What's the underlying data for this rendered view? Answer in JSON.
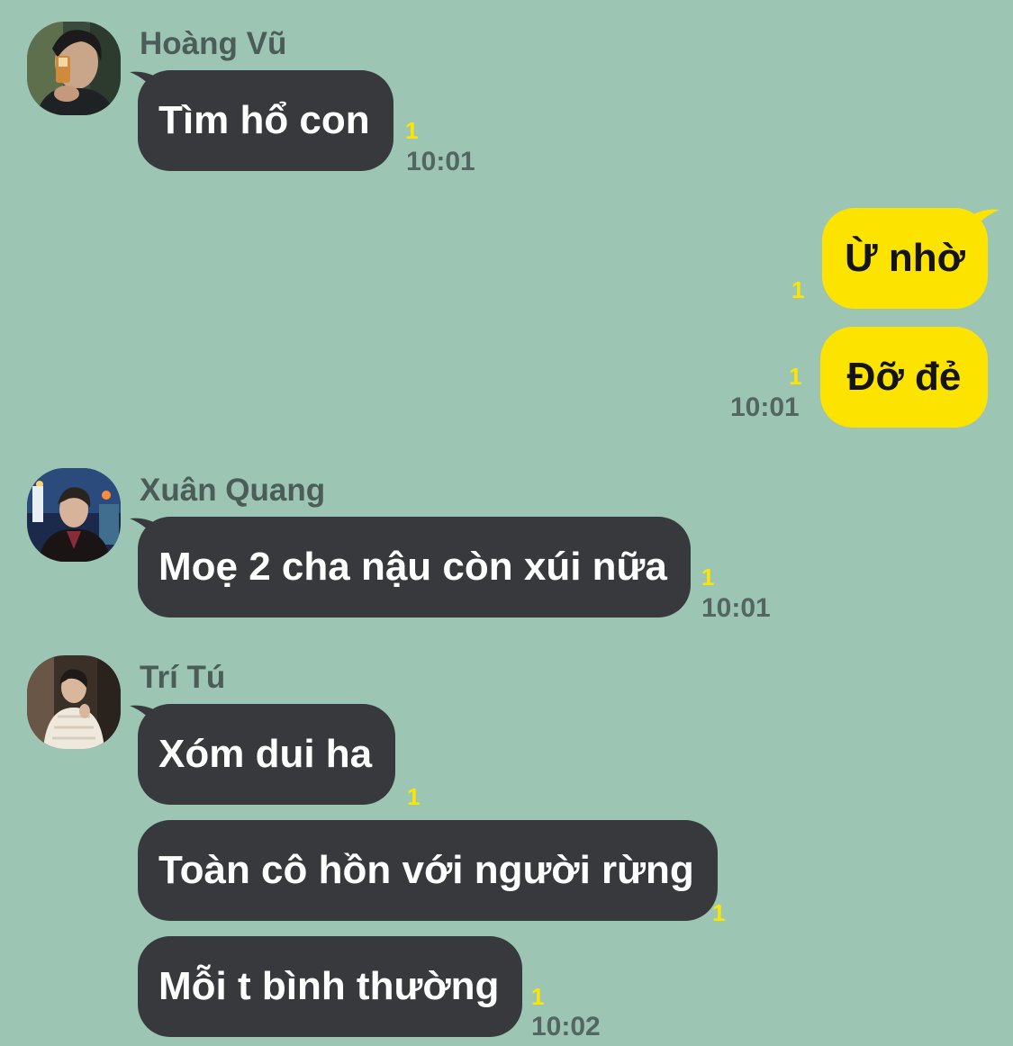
{
  "colors": {
    "background": "#9cc5b4",
    "incoming_bubble": "#37393d",
    "outgoing_bubble": "#fde300",
    "unread_count": "#fce500",
    "meta_text": "#536660"
  },
  "messages": {
    "hoang_vu": {
      "sender": "Hoàng Vũ",
      "avatar": "profile-photo",
      "text": "Tìm hổ con",
      "unread": "1",
      "time": "10:01"
    },
    "me_1": {
      "text": "Ừ nhờ",
      "unread": "1"
    },
    "me_2": {
      "text": "Đỡ đẻ",
      "unread": "1",
      "time": "10:01"
    },
    "xuan_quang": {
      "sender": "Xuân Quang",
      "avatar": "profile-photo",
      "text": "Moẹ 2 cha nậu còn xúi nữa",
      "unread": "1",
      "time": "10:01"
    },
    "tri_tu": {
      "sender": "Trí Tú",
      "avatar": "profile-photo",
      "msg1": {
        "text": "Xóm dui ha",
        "unread": "1"
      },
      "msg2": {
        "text": "Toàn cô hồn với người rừng",
        "unread": "1"
      },
      "msg3": {
        "text": "Mỗi t bình thường",
        "unread": "1",
        "time": "10:02"
      }
    }
  }
}
